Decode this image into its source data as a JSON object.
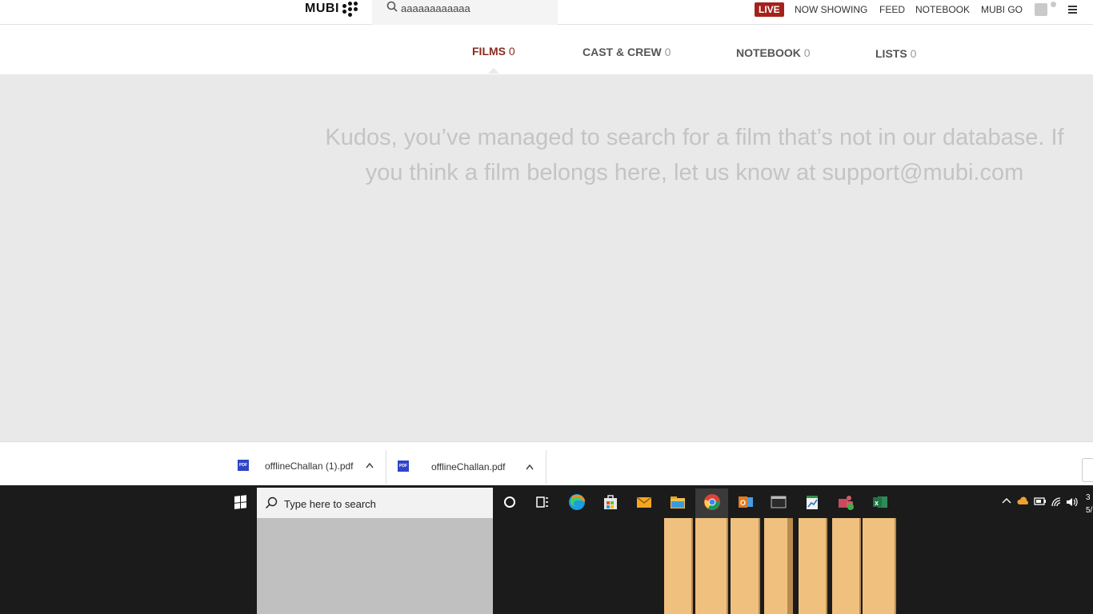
{
  "browser": {
    "top_nav": {
      "logo_text": "MUBI",
      "search_value": "aaaaaaaaaaaa",
      "live_label": "LIVE",
      "links": [
        "NOW SHOWING",
        "FEED",
        "NOTEBOOK",
        "MUBI GO"
      ]
    },
    "tabs": [
      {
        "label": "FILMS",
        "count": "0",
        "active": true
      },
      {
        "label": "CAST & CREW",
        "count": "0",
        "active": false
      },
      {
        "label": "NOTEBOOK",
        "count": "0",
        "active": false
      },
      {
        "label": "LISTS",
        "count": "0",
        "active": false
      }
    ],
    "empty_message": "Kudos, you’ve managed to search for a film that’s not in our database. If you think a film belongs here, let us know at support@mubi.com",
    "downloads": [
      {
        "icon_label": "PDF",
        "name": "offlineChallan (1).pdf"
      },
      {
        "icon_label": "PDF",
        "name": "offlineChallan.pdf"
      }
    ],
    "colors": {
      "accent": "#a4221a",
      "active_tab": "#8a2a1e"
    }
  },
  "taskbar": {
    "search_placeholder": "Type here to search",
    "pinned_icons": [
      "cortana-icon",
      "task-view-icon",
      "edge-icon",
      "store-icon",
      "mail-icon",
      "file-explorer-icon",
      "chrome-icon",
      "outlook-icon",
      "terminal-icon",
      "notepad-chart-icon",
      "teams-icon",
      "excel-icon"
    ],
    "tray_icons": [
      "chevron-up-icon",
      "onedrive-icon",
      "battery-icon",
      "wifi-icon",
      "volume-icon"
    ],
    "clock": {
      "time": "3",
      "date": "5/"
    }
  }
}
